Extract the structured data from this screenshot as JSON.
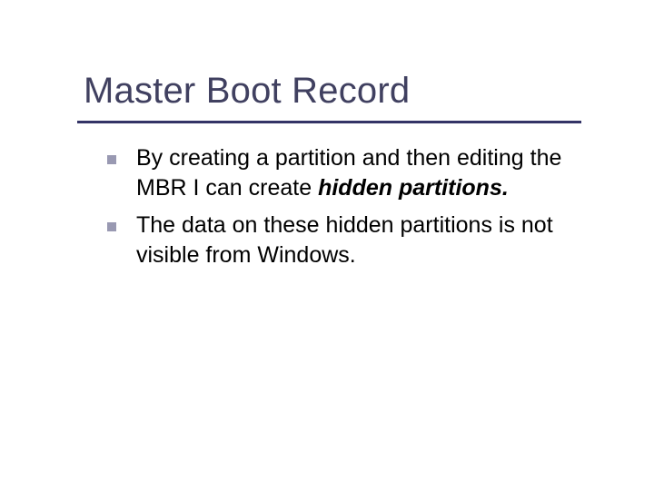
{
  "slide": {
    "title": "Master Boot Record",
    "bullets": [
      {
        "pre": "By creating a partition and then editing the MBR I can create ",
        "emph": "hidden partitions."
      },
      {
        "pre": "The data on these hidden partitions is not visible from Windows."
      }
    ]
  }
}
